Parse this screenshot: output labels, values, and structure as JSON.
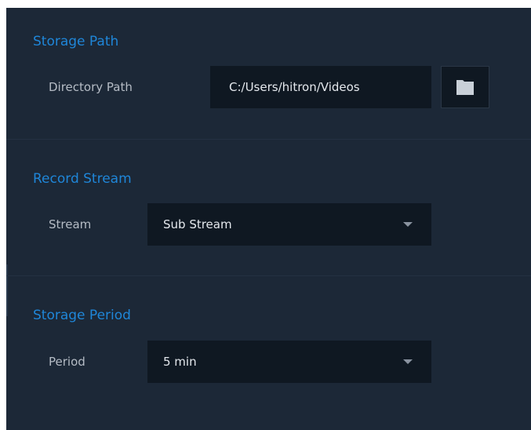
{
  "storage_path": {
    "section_title": "Storage Path",
    "directory_label": "Directory Path",
    "directory_value": "C:/Users/hitron/Videos",
    "browse_icon": "folder-icon"
  },
  "record_stream": {
    "section_title": "Record Stream",
    "stream_label": "Stream",
    "stream_value": "Sub Stream",
    "dropdown_icon": "chevron-down-icon"
  },
  "storage_period": {
    "section_title": "Storage Period",
    "period_label": "Period",
    "period_value": "5 min",
    "dropdown_icon": "chevron-down-icon"
  },
  "colors": {
    "panel_bg": "#1c2837",
    "field_bg": "#0f1822",
    "accent": "#1f86d8",
    "label_text": "#b5bcc5",
    "value_text": "#e4e8ed"
  }
}
